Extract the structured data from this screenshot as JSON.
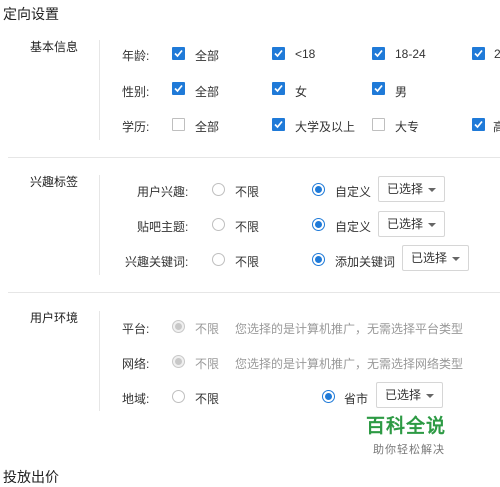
{
  "page": {
    "title": "定向设置",
    "footer_title": "投放出价"
  },
  "basic": {
    "title": "基本信息",
    "age": {
      "label": "年龄:",
      "options": [
        {
          "label": "全部",
          "checked": true
        },
        {
          "label": "<18",
          "checked": true
        },
        {
          "label": "18-24",
          "checked": true
        },
        {
          "label": "2",
          "checked": true
        }
      ]
    },
    "gender": {
      "label": "性别:",
      "options": [
        {
          "label": "全部",
          "checked": true
        },
        {
          "label": "女",
          "checked": true
        },
        {
          "label": "男",
          "checked": true
        }
      ]
    },
    "education": {
      "label": "学历:",
      "options": [
        {
          "label": "全部",
          "checked": false
        },
        {
          "label": "大学及以上",
          "checked": true
        },
        {
          "label": "大专",
          "checked": false
        },
        {
          "label": "高",
          "checked": true
        }
      ]
    }
  },
  "interest": {
    "title": "兴趣标签",
    "rows": [
      {
        "label": "用户兴趣:",
        "opt_unlimited": "不限",
        "opt_selected": "自定义",
        "dropdown": "已选择"
      },
      {
        "label": "贴吧主题:",
        "opt_unlimited": "不限",
        "opt_selected": "自定义",
        "dropdown": "已选择"
      },
      {
        "label": "兴趣关键词:",
        "opt_unlimited": "不限",
        "opt_selected": "添加关键词",
        "dropdown": "已选择"
      }
    ]
  },
  "env": {
    "title": "用户环境",
    "platform": {
      "label": "平台:",
      "opt": "不限",
      "note": "您选择的是计算机推广，无需选择平台类型"
    },
    "network": {
      "label": "网络:",
      "opt": "不限",
      "note": "您选择的是计算机推广，无需选择网络类型"
    },
    "region": {
      "label": "地域:",
      "opt_unlimited": "不限",
      "opt_selected": "省市",
      "dropdown": "已选择"
    }
  },
  "watermark": {
    "title": "百科全说",
    "subtitle": "助你轻松解决",
    "color": "#2d9a44"
  },
  "colors": {
    "accent": "#1f7ad8"
  }
}
